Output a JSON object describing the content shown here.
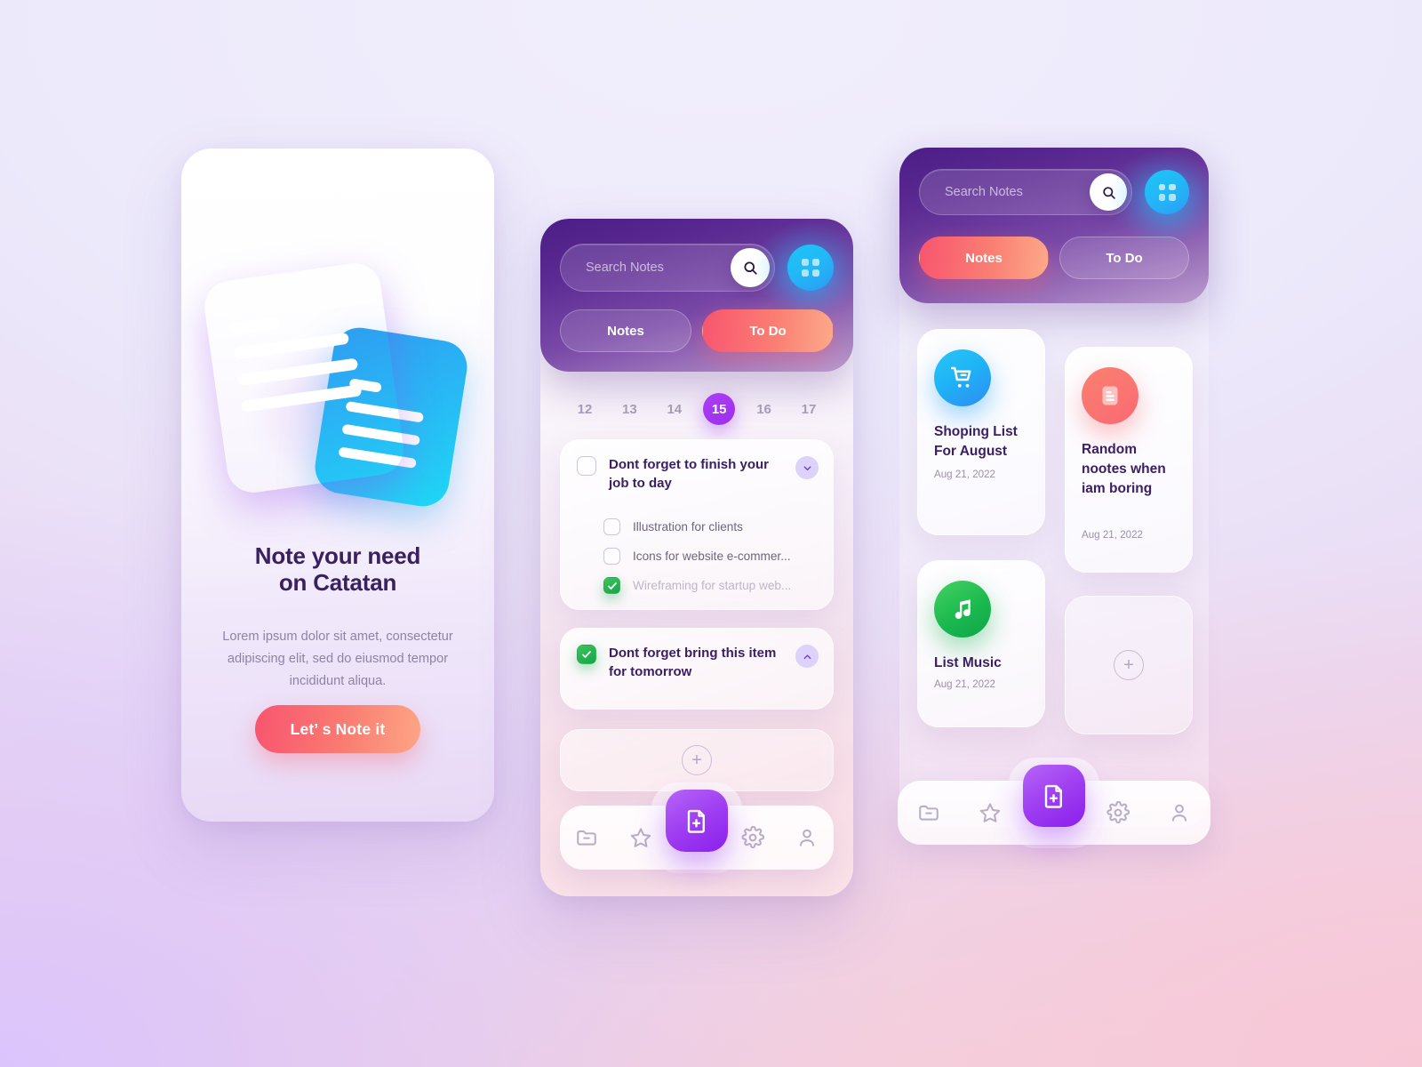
{
  "background": {
    "top_color": "#f1eefc",
    "bottom_left_color": "#dac4fd",
    "bottom_right_color": "#f8c6d6"
  },
  "onboarding": {
    "title_line1": "Note your need",
    "title_line2": "on Catatan",
    "body": "Lorem ipsum dolor sit amet, consectetur adipiscing elit, sed do eiusmod tempor incididunt  aliqua.",
    "cta_label": "Let’ s Note it",
    "cta_gradient": [
      "#f8556f",
      "#fca585"
    ],
    "illustration": {
      "front_card": "purple-note-document",
      "back_card": "cyan-note-document"
    }
  },
  "todo_screen": {
    "search": {
      "placeholder": "Search Notes",
      "value": "",
      "icon": "search-icon"
    },
    "grid_button_icon": "grid-view-icon",
    "tabs": [
      {
        "label": "Notes",
        "active": false
      },
      {
        "label": "To Do",
        "active": true
      }
    ],
    "dates": [
      {
        "day": "12",
        "active": false
      },
      {
        "day": "13",
        "active": false
      },
      {
        "day": "14",
        "active": false
      },
      {
        "day": "15",
        "active": true
      },
      {
        "day": "16",
        "active": false
      },
      {
        "day": "17",
        "active": false
      }
    ],
    "tasks": [
      {
        "title": "Dont forget to finish your job to day",
        "checked": false,
        "expanded": true,
        "chevron": "chevron-down-icon",
        "subtasks": [
          {
            "label": "Illustration for clients",
            "checked": false
          },
          {
            "label": "Icons for website e-commer...",
            "checked": false
          },
          {
            "label": "Wireframing for startup web...",
            "checked": true
          }
        ]
      },
      {
        "title": "Dont forget bring this item for tomorrow",
        "checked": true,
        "expanded": false,
        "chevron": "chevron-up-icon",
        "subtasks": []
      }
    ],
    "add_task_icon": "plus-circle-icon"
  },
  "notes_screen": {
    "search": {
      "placeholder": "Search Notes",
      "value": "",
      "icon": "search-icon"
    },
    "grid_button_icon": "grid-view-icon",
    "tabs": [
      {
        "label": "Notes",
        "active": true
      },
      {
        "label": "To Do",
        "active": false
      }
    ],
    "notes": [
      {
        "title": "Shoping List For August",
        "date": "Aug 21, 2022",
        "icon": "shopping-cart-icon",
        "color": "#1eb4f6"
      },
      {
        "title": "Random nootes when iam boring",
        "date": "Aug 21, 2022",
        "icon": "document-lines-icon",
        "color": "#f96a72"
      },
      {
        "title": "List Music",
        "date": "Aug 21, 2022",
        "icon": "music-note-icon",
        "color": "#1bb94f"
      }
    ],
    "add_note_icon": "plus-circle-icon"
  },
  "bottom_nav": {
    "items": [
      {
        "icon": "folder-minus-icon",
        "name": "folder"
      },
      {
        "icon": "star-icon",
        "name": "favorites"
      },
      {
        "icon": "gear-icon",
        "name": "settings"
      },
      {
        "icon": "user-icon",
        "name": "profile"
      }
    ],
    "fab_icon": "file-plus-icon",
    "fab_gradient": [
      "#b565f6",
      "#8a1fec"
    ]
  }
}
